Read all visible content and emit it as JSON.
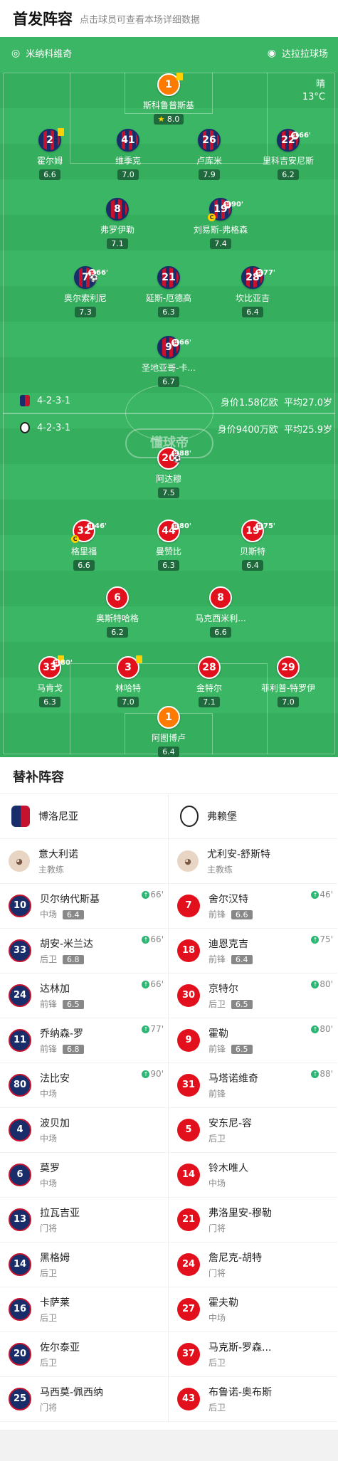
{
  "header": {
    "title": "首发阵容",
    "subtitle": "点击球员可查看本场详细数据"
  },
  "field": {
    "home_team": "米纳科维奇",
    "away_team": "达拉拉球场",
    "weather": "晴",
    "temperature": "13°C",
    "watermark": "懂球帝",
    "bol_formation": "4-2-3-1",
    "bol_value": "身价1.58亿欧",
    "bol_age": "平均27.0岁",
    "fre_formation": "4-2-3-1",
    "fre_value": "身价9400万欧",
    "fre_age": "平均25.9岁"
  },
  "bologna": [
    {
      "num": "1",
      "name": "斯科鲁普斯基",
      "rating": "8.0",
      "gk": true,
      "yellow": true,
      "star": true
    },
    {
      "num": "2",
      "name": "霍尔姆",
      "rating": "6.6",
      "yellow": true
    },
    {
      "num": "41",
      "name": "维季克",
      "rating": "7.0"
    },
    {
      "num": "26",
      "name": "卢库米",
      "rating": "7.9"
    },
    {
      "num": "22",
      "name": "里科吉安尼斯",
      "rating": "6.2",
      "sub": "66'"
    },
    {
      "num": "8",
      "name": "弗罗伊勒",
      "rating": "7.1"
    },
    {
      "num": "19",
      "name": "刘易斯-弗格森",
      "rating": "7.4",
      "sub": "90'",
      "captain": true
    },
    {
      "num": "7",
      "name": "奥尔索利尼",
      "rating": "7.3",
      "sub": "66'",
      "goal": true
    },
    {
      "num": "21",
      "name": "延斯-厄德高",
      "rating": "6.3"
    },
    {
      "num": "28",
      "name": "坎比亚吉",
      "rating": "6.4",
      "sub": "77'"
    },
    {
      "num": "9",
      "name": "圣地亚哥-卡...",
      "rating": "6.7",
      "sub": "66'"
    }
  ],
  "freiburg": [
    {
      "num": "20",
      "name": "阿达穆",
      "rating": "7.5",
      "sub": "88'",
      "goal": true
    },
    {
      "num": "32",
      "name": "格里福",
      "rating": "6.6",
      "sub": "46'",
      "captain": true
    },
    {
      "num": "44",
      "name": "曼赞比",
      "rating": "6.3",
      "sub": "80'"
    },
    {
      "num": "19",
      "name": "贝斯特",
      "rating": "6.4",
      "sub": "75'"
    },
    {
      "num": "6",
      "name": "奥斯特哈格",
      "rating": "6.2"
    },
    {
      "num": "8",
      "name": "马克西米利...",
      "rating": "6.6"
    },
    {
      "num": "33",
      "name": "马肯戈",
      "rating": "6.3",
      "yellow": true,
      "sub": "80'"
    },
    {
      "num": "3",
      "name": "林哈特",
      "rating": "7.0",
      "yellow": true
    },
    {
      "num": "28",
      "name": "金特尔",
      "rating": "7.1"
    },
    {
      "num": "29",
      "name": "菲利普-特罗伊",
      "rating": "7.0"
    },
    {
      "num": "1",
      "name": "阿图博卢",
      "rating": "6.4",
      "gk": true
    }
  ],
  "subs": {
    "title": "替补阵容",
    "left_team": "博洛尼亚",
    "right_team": "弗赖堡",
    "left_coach": "意大利诺",
    "right_coach": "尤利安-舒斯特",
    "coach_role": "主教练",
    "left": [
      {
        "num": "10",
        "name": "贝尔纳代斯基",
        "pos": "中场",
        "rating": "6.4",
        "time": "66'"
      },
      {
        "num": "33",
        "name": "胡安-米兰达",
        "pos": "后卫",
        "rating": "6.8",
        "time": "66'"
      },
      {
        "num": "24",
        "name": "达林加",
        "pos": "前锋",
        "rating": "6.5",
        "time": "66'"
      },
      {
        "num": "11",
        "name": "乔纳森-罗",
        "pos": "前锋",
        "rating": "6.8",
        "time": "77'"
      },
      {
        "num": "80",
        "name": "法比安",
        "pos": "中场",
        "time": "90'"
      },
      {
        "num": "4",
        "name": "波贝加",
        "pos": "中场"
      },
      {
        "num": "6",
        "name": "莫罗",
        "pos": "中场"
      },
      {
        "num": "13",
        "name": "拉瓦吉亚",
        "pos": "门将"
      },
      {
        "num": "14",
        "name": "黑格姆",
        "pos": "后卫"
      },
      {
        "num": "16",
        "name": "卡萨莱",
        "pos": "后卫"
      },
      {
        "num": "20",
        "name": "佐尔泰亚",
        "pos": "后卫"
      },
      {
        "num": "25",
        "name": "马西莫-佩西纳",
        "pos": "门将"
      }
    ],
    "right": [
      {
        "num": "7",
        "name": "舍尔汉特",
        "pos": "前锋",
        "rating": "6.6",
        "time": "46'"
      },
      {
        "num": "18",
        "name": "迪恩克吉",
        "pos": "前锋",
        "rating": "6.4",
        "time": "75'"
      },
      {
        "num": "30",
        "name": "京特尔",
        "pos": "后卫",
        "rating": "6.5",
        "time": "80'"
      },
      {
        "num": "9",
        "name": "霍勒",
        "pos": "前锋",
        "rating": "6.5",
        "time": "80'"
      },
      {
        "num": "31",
        "name": "马塔诺维奇",
        "pos": "前锋",
        "time": "88'"
      },
      {
        "num": "5",
        "name": "安东尼-容",
        "pos": "后卫"
      },
      {
        "num": "14",
        "name": "铃木唯人",
        "pos": "中场"
      },
      {
        "num": "21",
        "name": "弗洛里安-穆勒",
        "pos": "门将"
      },
      {
        "num": "24",
        "name": "詹尼克-胡特",
        "pos": "门将"
      },
      {
        "num": "27",
        "name": "霍夫勒",
        "pos": "中场"
      },
      {
        "num": "37",
        "name": "马克斯-罗森...",
        "pos": "后卫"
      },
      {
        "num": "43",
        "name": "布鲁诺-奥布斯",
        "pos": "后卫"
      }
    ]
  },
  "colors": {
    "pitch": "#35ae5d",
    "bologna_navy": "#1a2d6b",
    "bologna_red": "#c4122f",
    "freiburg_red": "#e2101c",
    "gk_orange": "#ff7a00"
  }
}
